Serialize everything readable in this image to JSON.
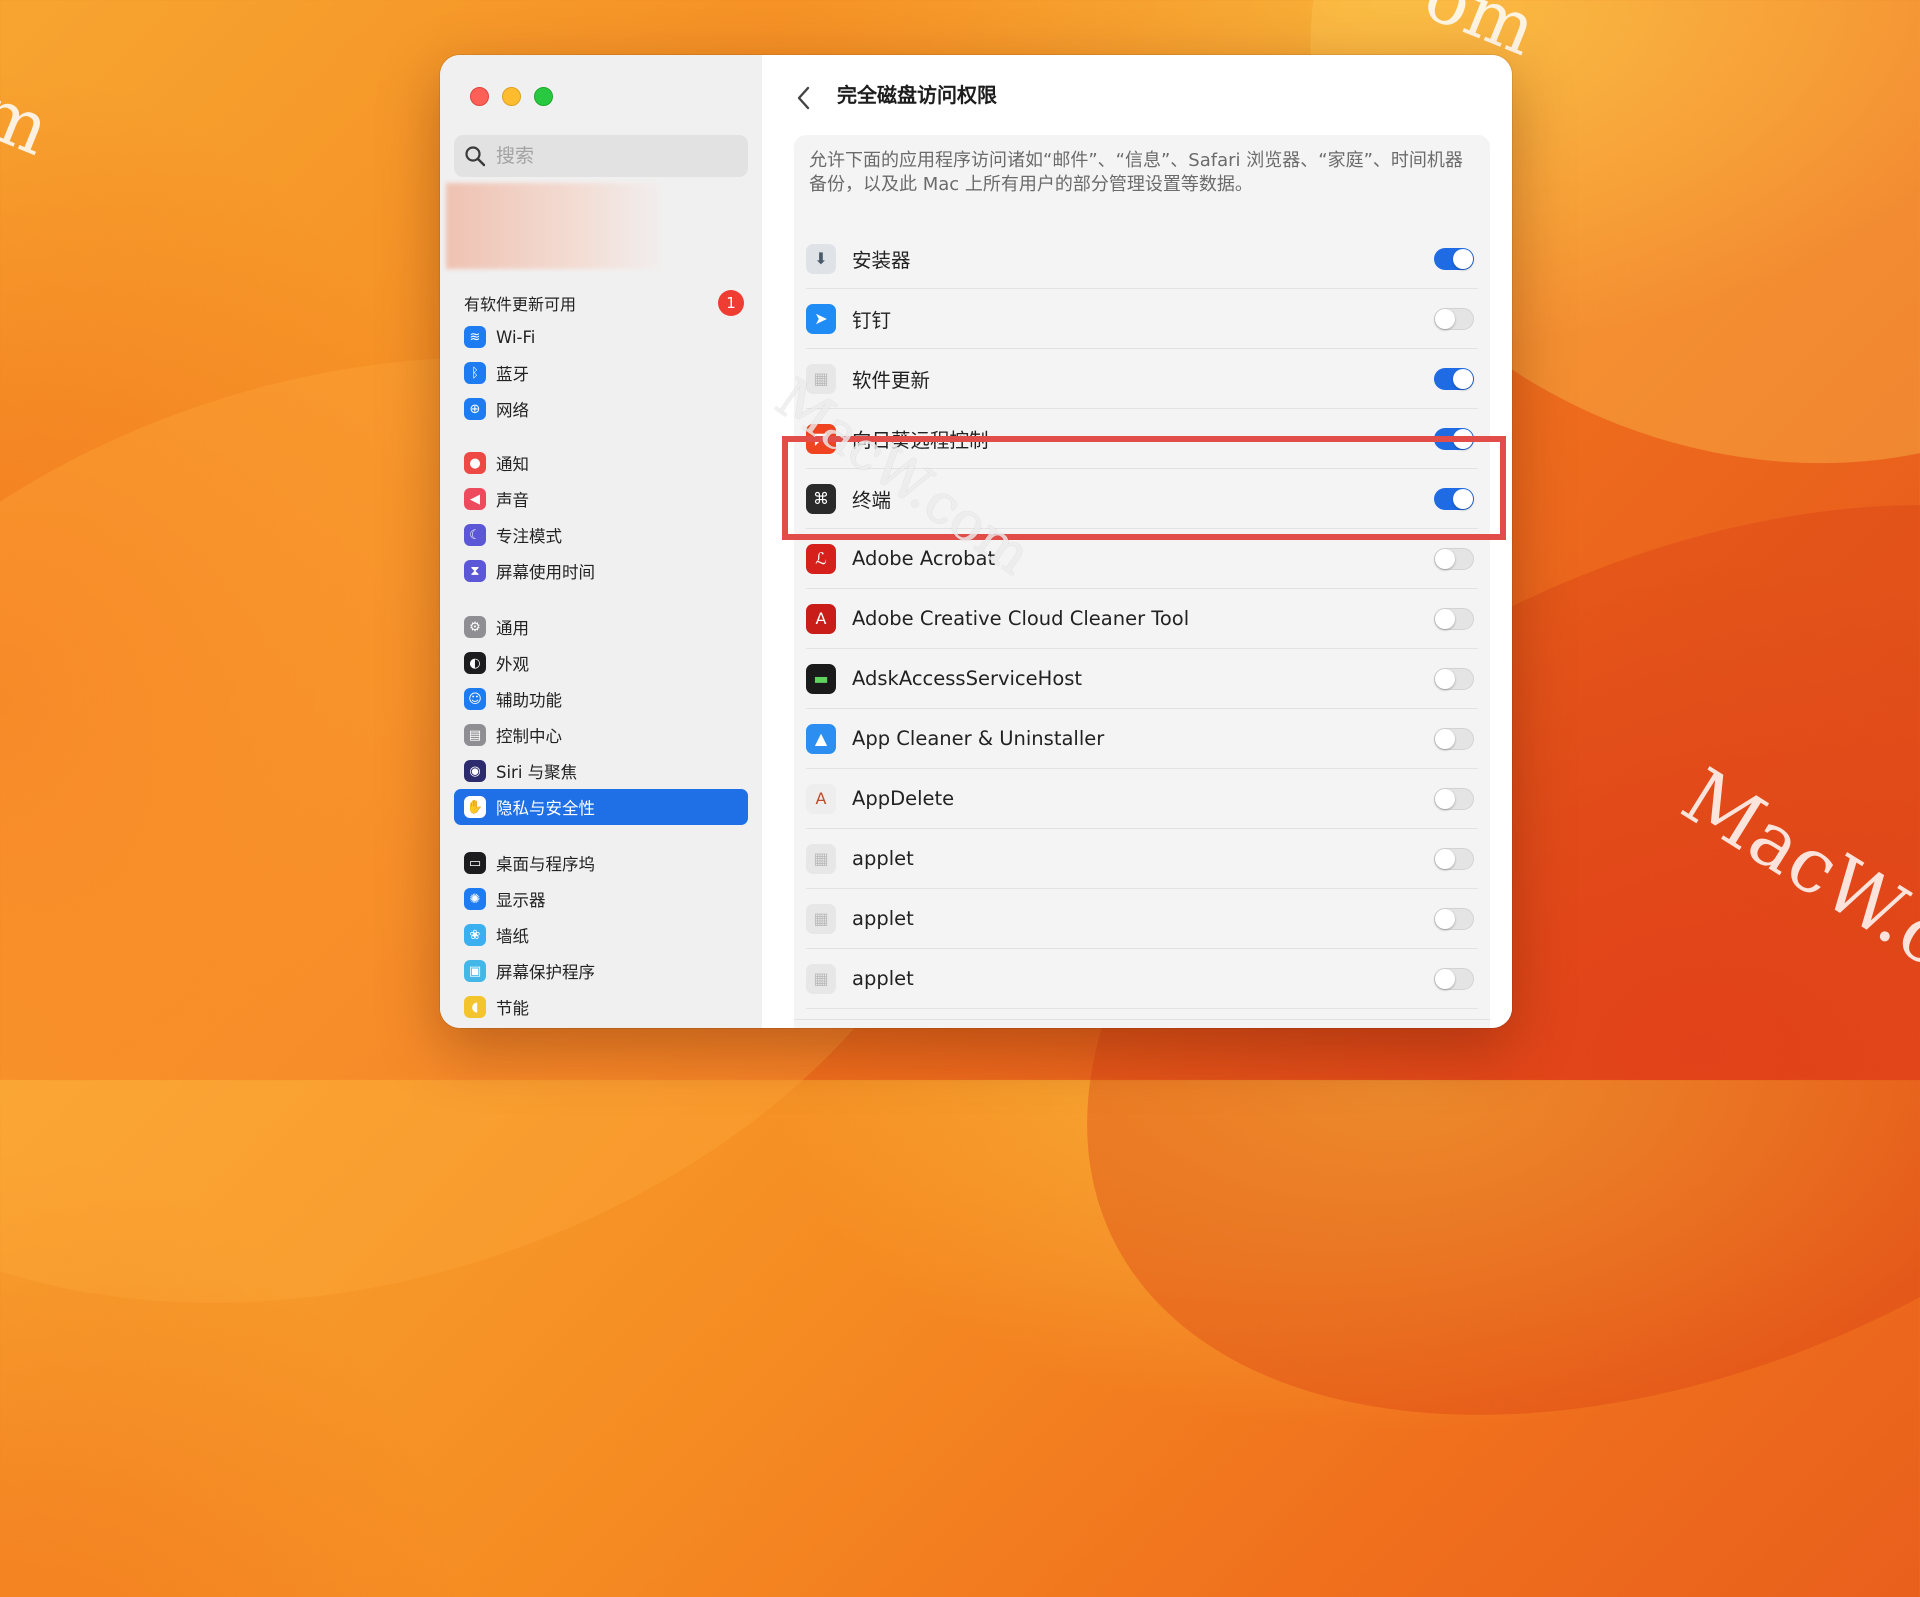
{
  "window": {
    "title": "完全磁盘访问权限"
  },
  "search": {
    "placeholder": "搜索"
  },
  "update_notice": {
    "label": "有软件更新可用",
    "badge": "1"
  },
  "sidebar": {
    "items": [
      {
        "label": "Wi-Fi",
        "icon": "wifi-icon",
        "color": "#1e7cf2",
        "glyph": "≋"
      },
      {
        "label": "蓝牙",
        "icon": "bluetooth-icon",
        "color": "#1e7cf2",
        "glyph": "ᛒ"
      },
      {
        "label": "网络",
        "icon": "globe-icon",
        "color": "#1e7cf2",
        "glyph": "⊕"
      },
      {
        "label": "通知",
        "icon": "bell-icon",
        "color": "#ee4a45",
        "glyph": "●"
      },
      {
        "label": "声音",
        "icon": "speaker-icon",
        "color": "#ee4a5e",
        "glyph": "◀"
      },
      {
        "label": "专注模式",
        "icon": "moon-icon",
        "color": "#5b57d6",
        "glyph": "☾"
      },
      {
        "label": "屏幕使用时间",
        "icon": "hourglass-icon",
        "color": "#5b57d6",
        "glyph": "⧗"
      },
      {
        "label": "通用",
        "icon": "gear-icon",
        "color": "#8e8e93",
        "glyph": "⚙"
      },
      {
        "label": "外观",
        "icon": "appearance-icon",
        "color": "#1c1c1e",
        "glyph": "◐"
      },
      {
        "label": "辅助功能",
        "icon": "accessibility-icon",
        "color": "#1e7cf2",
        "glyph": "☺"
      },
      {
        "label": "控制中心",
        "icon": "control-center-icon",
        "color": "#8e8e93",
        "glyph": "▤"
      },
      {
        "label": "Siri 与聚焦",
        "icon": "siri-icon",
        "color": "#2b2b6e",
        "glyph": "◉"
      },
      {
        "label": "隐私与安全性",
        "icon": "hand-icon",
        "color": "#2d7cf6",
        "glyph": "✋",
        "selected": true
      },
      {
        "label": "桌面与程序坞",
        "icon": "dock-icon",
        "color": "#1c1c1e",
        "glyph": "▭"
      },
      {
        "label": "显示器",
        "icon": "display-icon",
        "color": "#1e7cf2",
        "glyph": "✺"
      },
      {
        "label": "墙纸",
        "icon": "wallpaper-icon",
        "color": "#3ab0f0",
        "glyph": "❀"
      },
      {
        "label": "屏幕保护程序",
        "icon": "screensaver-icon",
        "color": "#43b8e8",
        "glyph": "▣"
      },
      {
        "label": "节能",
        "icon": "battery-icon",
        "color": "#f3c42b",
        "glyph": "◖"
      }
    ]
  },
  "description": "允许下面的应用程序访问诸如“邮件”、“信息”、Safari 浏览器、“家庭”、时间机器备份，以及此 Mac 上所有用户的部分管理设置等数据。",
  "apps": [
    {
      "name": "安装器",
      "icon": "installer-icon",
      "enabled": true
    },
    {
      "name": "钉钉",
      "icon": "dingtalk-icon",
      "enabled": false
    },
    {
      "name": "软件更新",
      "icon": "software-update-icon",
      "enabled": true
    },
    {
      "name": "向日葵远程控制",
      "icon": "sunflower-icon",
      "enabled": true
    },
    {
      "name": "终端",
      "icon": "terminal-icon",
      "enabled": true
    },
    {
      "name": "Adobe Acrobat",
      "icon": "acrobat-icon",
      "enabled": false
    },
    {
      "name": "Adobe Creative Cloud Cleaner Tool",
      "icon": "adobe-cleaner-icon",
      "enabled": false
    },
    {
      "name": "AdskAccessServiceHost",
      "icon": "adsk-icon",
      "enabled": false
    },
    {
      "name": "App Cleaner & Uninstaller",
      "icon": "app-cleaner-icon",
      "enabled": false
    },
    {
      "name": "AppDelete",
      "icon": "appdelete-icon",
      "enabled": false
    },
    {
      "name": "applet",
      "icon": "applet-icon",
      "enabled": false
    },
    {
      "name": "applet",
      "icon": "applet-icon",
      "enabled": false
    },
    {
      "name": "applet",
      "icon": "applet-icon",
      "enabled": false
    }
  ],
  "footer": {
    "add": "+",
    "remove": "−"
  },
  "watermarks": {
    "background_left": "m",
    "background_top": "om",
    "background_right": "MacW.co",
    "window": "MacW.com"
  },
  "colors": {
    "accent": "#1f6fe6",
    "highlight": "#e24d4a",
    "badge": "#ef3d33"
  }
}
